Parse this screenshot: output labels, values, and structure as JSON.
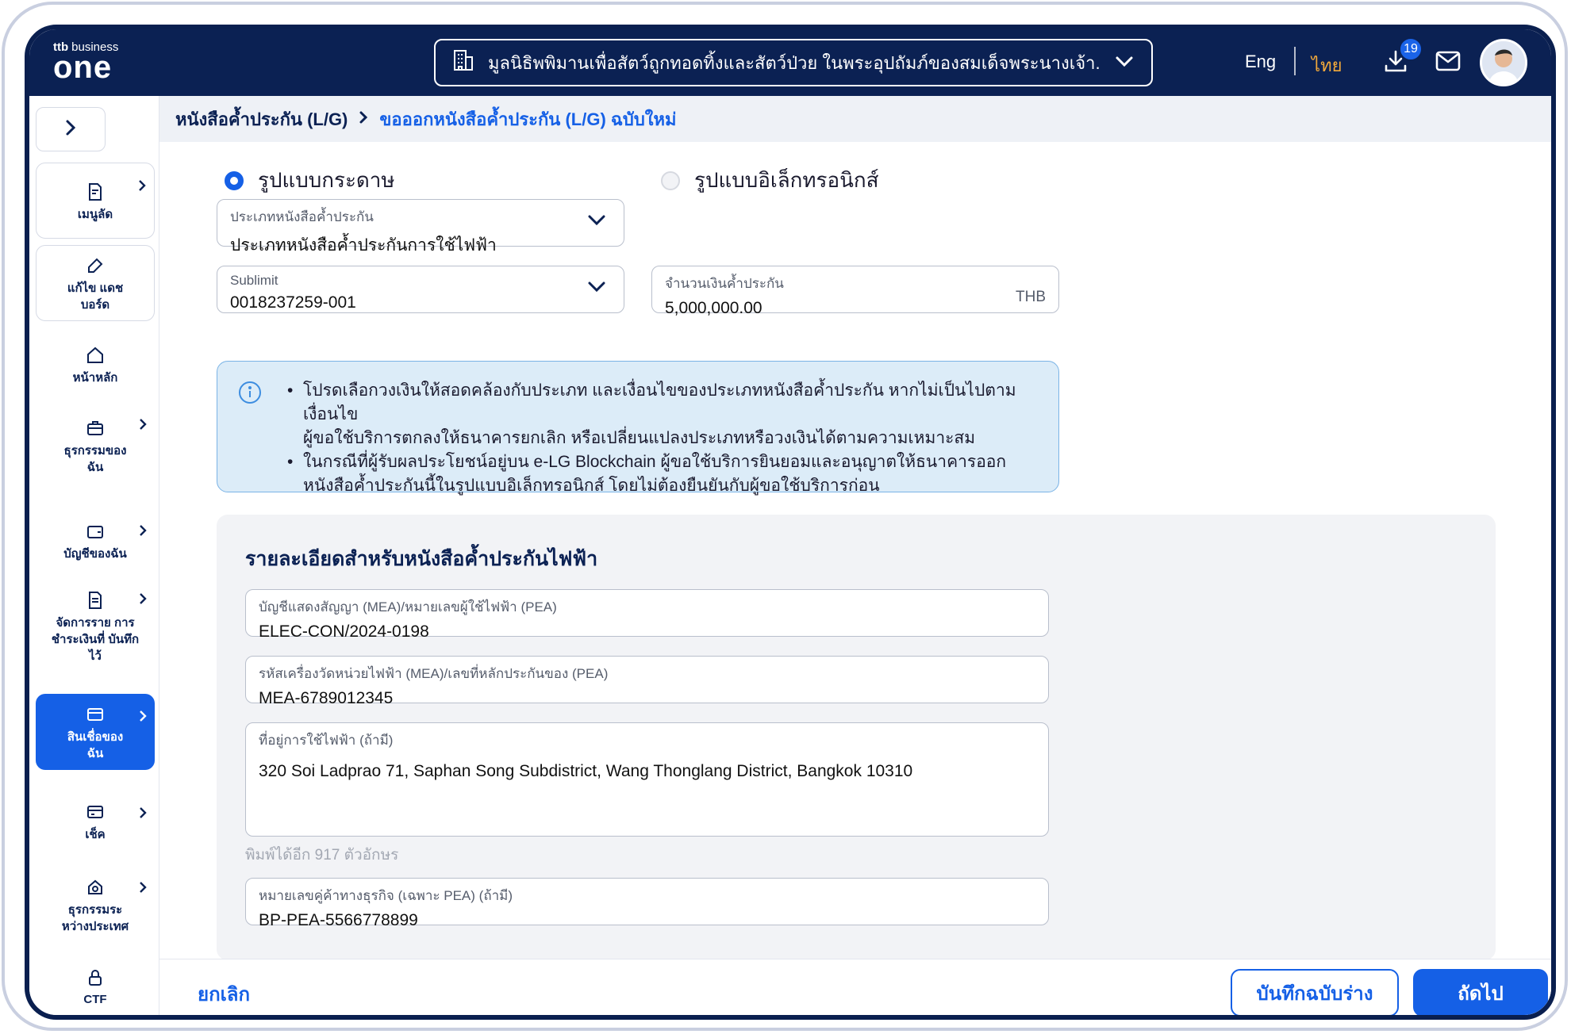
{
  "header": {
    "logo_small": "business",
    "logo_brand_mark": "ttb",
    "logo_big": "one",
    "organization": "มูลนิธิพพิมานเพื่อสัตว์ถูกทอดทิ้งและสัตว์ป่วย ในพระอุปถัมภ์ของสมเด็จพระนางเจ้า...",
    "lang_en": "Eng",
    "lang_th": "ไทย",
    "download_badge": "19"
  },
  "sidebar": {
    "items": [
      {
        "label": "เมนูลัด",
        "icon": "document-shortcut-icon"
      },
      {
        "label": "แก้ไข แดชบอร์ด",
        "icon": "edit-icon"
      },
      {
        "label": "หน้าหลัก",
        "icon": "home-icon"
      },
      {
        "label": "ธุรกรรมของ ฉัน",
        "icon": "briefcase-icon"
      },
      {
        "label": "บัญชีของฉัน",
        "icon": "wallet-icon"
      },
      {
        "label": "จัดการราย การชำระเงินที่ บันทึกไว้",
        "icon": "document-list-icon"
      },
      {
        "label": "สินเชื่อของ ฉัน",
        "icon": "card-icon"
      },
      {
        "label": "เช็ค",
        "icon": "cheque-icon"
      },
      {
        "label": "ธุรกรรมระ หว่างประเทศ",
        "icon": "international-icon"
      },
      {
        "label": "CTF",
        "icon": "lock-icon"
      }
    ]
  },
  "breadcrumb": {
    "parent": "หนังสือค้ำประกัน (L/G)",
    "current": "ขอออกหนังสือค้ำประกัน (L/G) ฉบับใหม่"
  },
  "form": {
    "format_paper": "รูปแบบกระดาษ",
    "format_electronic": "รูปแบบอิเล็กทรอนิกส์",
    "lg_type_label": "ประเภทหนังสือค้ำประกัน",
    "lg_type_value": "ประเภทหนังสือค้ำประกันการใช้ไฟฟ้า",
    "sublimit_label": "Sublimit",
    "sublimit_value": "0018237259-001",
    "amount_label": "จำนวนเงินค้ำประกัน",
    "amount_value": "5,000,000.00",
    "amount_unit": "THB"
  },
  "info": {
    "line1a": "โปรดเลือกวงเงินให้สอดคล้องกับประเภท และเงื่อนไขของประเภทหนังสือค้ำประกัน หากไม่เป็นไปตามเงื่อนไข",
    "line1b": "ผู้ขอใช้บริการตกลงให้ธนาคารยกเลิก หรือเปลี่ยนแปลงประเภทหรือวงเงินได้ตามความเหมาะสม",
    "line2a": "ในกรณีที่ผู้รับผลประโยชน์อยู่บน e-LG Blockchain ผู้ขอใช้บริการยินยอมและอนุญาตให้ธนาคารออก",
    "line2b": "หนังสือค้ำประกันนี้ในรูปแบบอิเล็กทรอนิกส์ โดยไม่ต้องยืนยันกับผู้ขอใช้บริการก่อน"
  },
  "details": {
    "title": "รายละเอียดสำหรับหนังสือค้ำประกันไฟฟ้า",
    "contract_label": "บัญชีแสดงสัญญา (MEA)/หมายเลขผู้ใช้ไฟฟ้า (PEA)",
    "contract_value": "ELEC-CON/2024-0198",
    "meter_label": "รหัสเครื่องวัดหน่วยไฟฟ้า (MEA)/เลขที่หลักประกันของ (PEA)",
    "meter_value": "MEA-6789012345",
    "address_label": "ที่อยู่การใช้ไฟฟ้า (ถ้ามี)",
    "address_value": "320 Soi Ladprao 71, Saphan Song Subdistrict, Wang Thonglang District, Bangkok 10310",
    "remaining_hint": "พิมพ์ได้อีก 917 ตัวอักษร",
    "bp_label": "หมายเลขคู่ค้าทางธุรกิจ (เฉพาะ PEA) (ถ้ามี)",
    "bp_value": "BP-PEA-5566778899"
  },
  "footer": {
    "cancel": "ยกเลิก",
    "save_draft": "บันทึกฉบับร่าง",
    "next": "ถัดไป"
  },
  "colors": {
    "navy": "#0b2153",
    "primary": "#1560e6",
    "accent_lang": "#f2a93b",
    "info_bg": "#dcecf8"
  }
}
